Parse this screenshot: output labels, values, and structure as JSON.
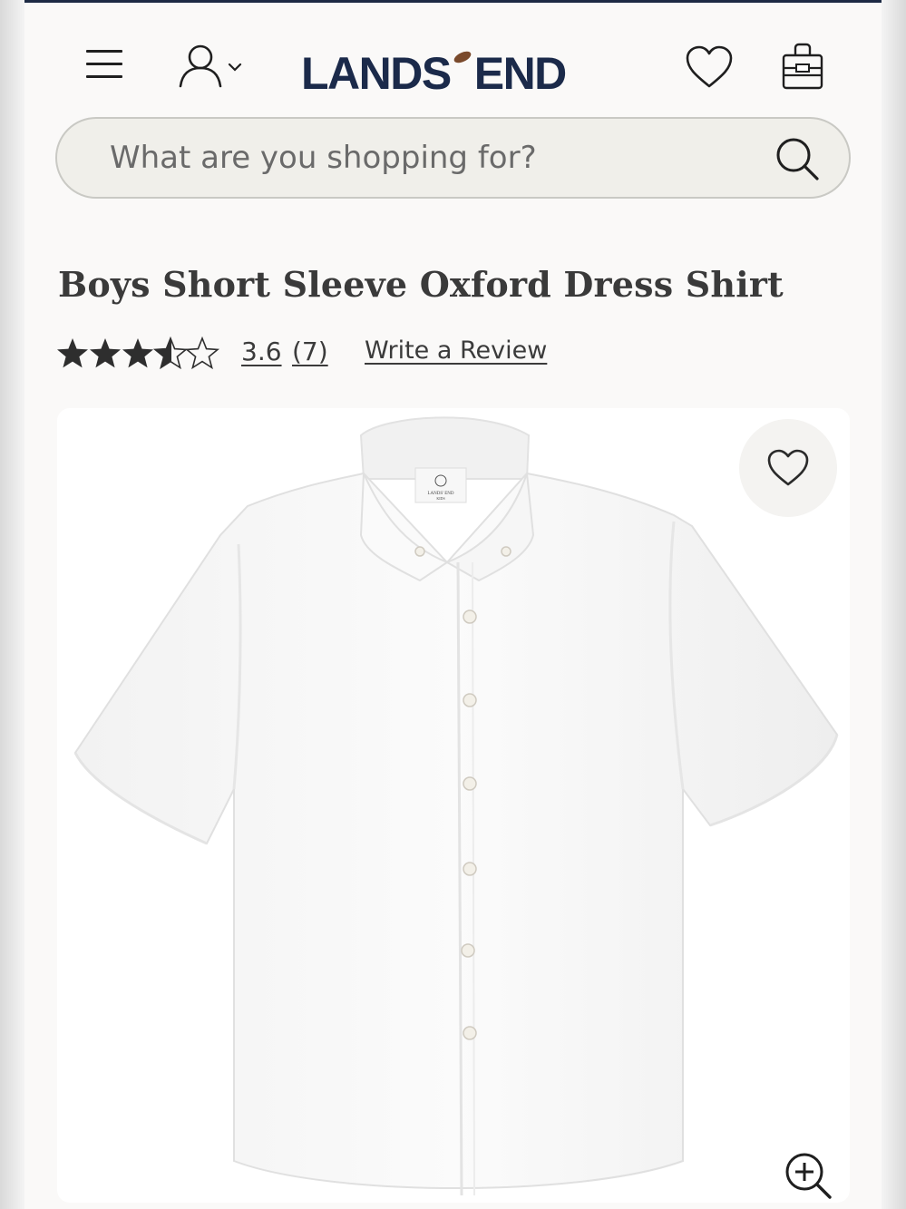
{
  "header": {
    "menu_icon": "hamburger-menu-icon",
    "account_icon": "user-icon",
    "logo_left": "LANDS",
    "logo_right": "END",
    "wishlist_icon": "heart-icon",
    "bag_icon": "shopping-bag-icon",
    "brand_color": "#1b2a4a"
  },
  "search": {
    "placeholder": "What are you shopping for?",
    "icon": "search-icon"
  },
  "product": {
    "title": "Boys Short Sleeve Oxford Dress Shirt",
    "rating": 3.6,
    "rating_display": "3.6",
    "review_count_display": "(7)",
    "write_review_label": "Write a Review",
    "image_alt": "White short sleeve oxford dress shirt",
    "tag_brand": "LANDS' END",
    "tag_sub": "KIDS",
    "favorite_icon": "heart-icon",
    "zoom_icon": "zoom-in-icon"
  }
}
